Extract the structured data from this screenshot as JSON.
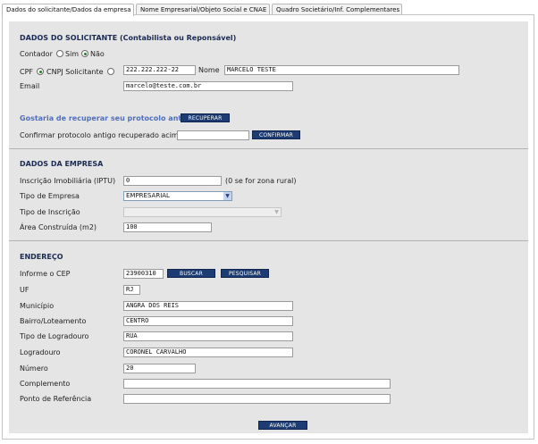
{
  "tabs": [
    {
      "label": "Dados do solicitante/Dados da empresa",
      "active": true
    },
    {
      "label": "Nome Empresarial/Objeto Social e CNAE",
      "active": false
    },
    {
      "label": "Quadro Societário/Inf. Complementares",
      "active": false
    }
  ],
  "solicitante": {
    "title": "DADOS DO SOLICITANTE (Contabilista ou Reponsável)",
    "contador_label": "Contador",
    "contador_sim": "Sim",
    "contador_nao": "Não",
    "contador_selected": "nao",
    "cpf_label": "CPF",
    "cnpj_label": "CNPJ Solicitante",
    "doc_selected": "cpf",
    "doc_value": "222.222.222-22",
    "nome_label": "Nome",
    "nome_value": "MARCELO TESTE",
    "email_label": "Email",
    "email_value": "marcelo@teste.com.br"
  },
  "protocolo": {
    "question": "Gostaria de recuperar seu protocolo antigo?",
    "recuperar_label": "RECUPERAR",
    "confirmar_text": "Confirmar protocolo antigo recuperado acima:",
    "confirmar_value": "",
    "confirmar_label": "CONFIRMAR"
  },
  "empresa": {
    "title": "DADOS DA EMPRESA",
    "iptu_label": "Inscrição Imobiliária (IPTU)",
    "iptu_value": "0",
    "iptu_hint": "(0 se for zona rural)",
    "tipo_empresa_label": "Tipo de Empresa",
    "tipo_empresa_value": "EMPRESARIAL",
    "tipo_inscricao_label": "Tipo de Inscrição",
    "tipo_inscricao_value": "",
    "area_label": "Área Construída (m2)",
    "area_value": "100"
  },
  "endereco": {
    "title": "ENDEREÇO",
    "cep_label": "Informe o CEP",
    "cep_value": "23900310",
    "buscar_label": "BUSCAR",
    "pesquisar_label": "PESQUISAR",
    "uf_label": "UF",
    "uf_value": "RJ",
    "municipio_label": "Município",
    "municipio_value": "ANGRA DOS REIS",
    "bairro_label": "Bairro/Loteamento",
    "bairro_value": "CENTRO",
    "tipo_logradouro_label": "Tipo de Logradouro",
    "tipo_logradouro_value": "RUA",
    "logradouro_label": "Logradouro",
    "logradouro_value": "CORONEL CARVALHO",
    "numero_label": "Número",
    "numero_value": "20",
    "complemento_label": "Complemento",
    "complemento_value": "",
    "referencia_label": "Ponto de Referência",
    "referencia_value": ""
  },
  "avancar_label": "AVANÇAR"
}
